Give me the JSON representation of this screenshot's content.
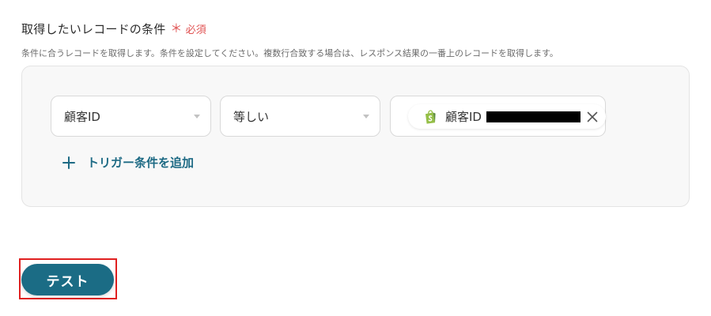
{
  "section": {
    "title": "取得したいレコードの条件",
    "required_mark": "＊",
    "required_text": "必須",
    "description": "条件に合うレコードを取得します。条件を設定してください。複数行合致する場合は、レスポンス結果の一番上のレコードを取得します。"
  },
  "condition": {
    "field": "顧客ID",
    "operator": "等しい",
    "value_chip": {
      "icon": "shopify-icon",
      "label": "顧客ID",
      "redacted": true
    }
  },
  "add_condition_label": "トリガー条件を追加",
  "test_button_label": "テスト",
  "colors": {
    "accent": "#1b6c85",
    "link": "#1d6a84",
    "required": "#e05252",
    "highlight": "#e02020",
    "shopify_green": "#95bf47"
  }
}
